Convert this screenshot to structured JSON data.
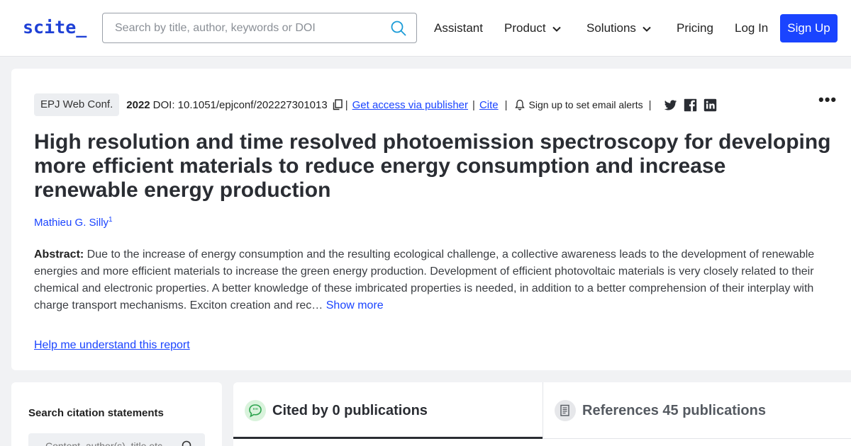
{
  "header": {
    "logo": "scite_",
    "search_placeholder": "Search by title, author, keywords or DOI",
    "nav": {
      "assistant": "Assistant",
      "product": "Product",
      "solutions": "Solutions",
      "pricing": "Pricing",
      "login": "Log In",
      "signup": "Sign Up"
    }
  },
  "paper": {
    "journal": "EPJ Web Conf.",
    "year": "2022",
    "doi": "DOI: 10.1051/epjconf/202227301013",
    "get_access": "Get access via publisher",
    "cite": "Cite",
    "alerts": "Sign up to set email alerts",
    "more_menu": "•••",
    "title": "High resolution and time resolved photoemission spectroscopy for developing more efficient materials to reduce energy consumption and increase renewable energy production",
    "author": "Mathieu G. Silly",
    "author_sup": "1",
    "abstract_label": "Abstract:",
    "abstract_text": " Due to the increase of energy consumption and the resulting ecological challenge, a collective awareness leads to the development of renewable energies and more efficient materials to increase the green energy production. Development of efficient photovoltaic materials is very closely related to their chemical and electronic properties. A better knowledge of these imbricated properties is needed, in addition to a better comprehension of their interplay with charge transport mechanisms. Exciton creation and rec…",
    "show_more": "Show more",
    "help_link": "Help me understand this report"
  },
  "sidebar": {
    "title": "Search citation statements",
    "input_placeholder": "Content, author(s), title etc."
  },
  "tabs": {
    "cited": "Cited by 0 publications",
    "references": "References 45 publications"
  },
  "colors": {
    "brand": "#1a44ff",
    "cited_icon_bg": "#d9f3dc",
    "cited_icon": "#2ea44f"
  }
}
